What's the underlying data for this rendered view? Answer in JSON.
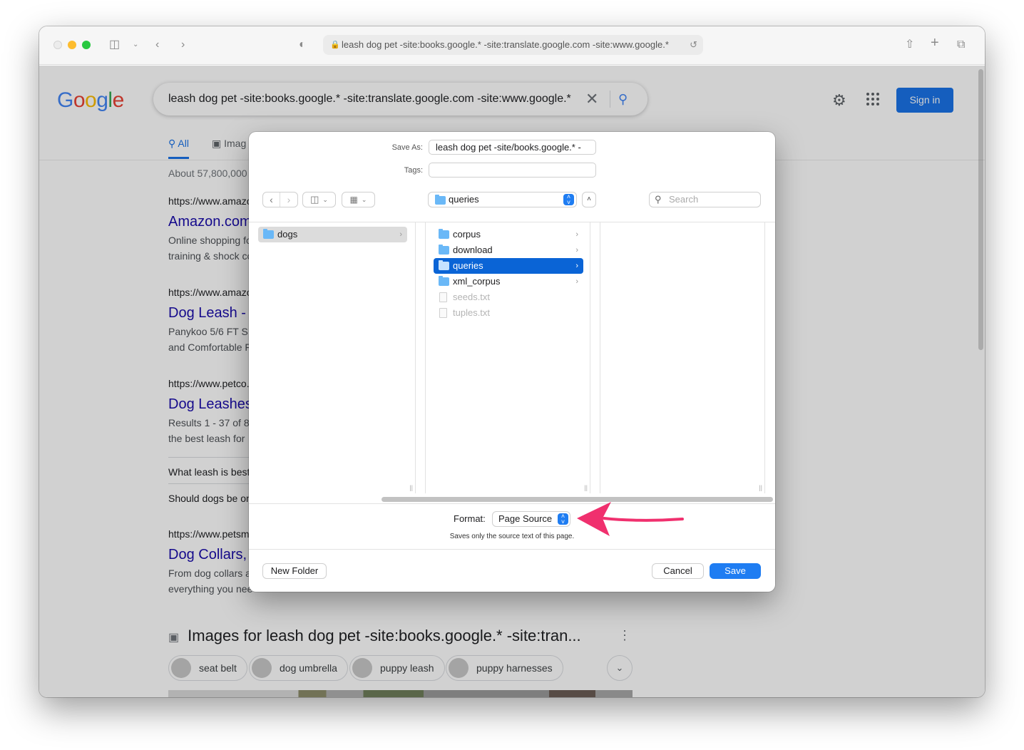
{
  "browser": {
    "address": "leash dog pet -site:books.google.* -site:translate.google.com -site:www.google.*"
  },
  "google": {
    "logo": "Google",
    "query": "leash dog pet -site:books.google.* -site:translate.google.com -site:www.google.*",
    "sign_in": "Sign in",
    "tabs": [
      {
        "label": "All"
      },
      {
        "label": "Imag"
      }
    ],
    "result_count": "About 57,800,000",
    "results": [
      {
        "url": "https://www.amazo",
        "title": "Amazon.com",
        "snippet1": "Online shopping fo",
        "snippet2": "training & shock co"
      },
      {
        "url": "https://www.amazo",
        "title": "Dog Leash -",
        "snippet1": "Panykoo 5/6 FT S",
        "snippet2": "and Comfortable F"
      },
      {
        "url": "https://www.petco.",
        "title": "Dog Leashes",
        "snippet1": "Results 1 - 37 of 8",
        "snippet2": "the best leash for"
      },
      {
        "url": "https://www.petsm",
        "title": "Dog Collars,",
        "snippet1": "From dog collars a",
        "snippet2": "everything you nee"
      }
    ],
    "paa": [
      "What leash is best",
      "Should dogs be on"
    ],
    "images_header": "Images for leash dog pet -site:books.google.* -site:tran...",
    "chips": [
      {
        "label": "seat belt"
      },
      {
        "label": "dog umbrella"
      },
      {
        "label": "puppy leash"
      },
      {
        "label": "puppy harnesses"
      }
    ]
  },
  "dialog": {
    "save_as_label": "Save As:",
    "save_as_value": "leash dog pet -site/books.google.* -",
    "tags_label": "Tags:",
    "tags_value": "",
    "location": "queries",
    "search_placeholder": "Search",
    "col0": [
      {
        "name": "dogs"
      }
    ],
    "col1": [
      {
        "name": "corpus"
      },
      {
        "name": "download"
      },
      {
        "name": "queries"
      },
      {
        "name": "xml_corpus"
      },
      {
        "name": "seeds.txt"
      },
      {
        "name": "tuples.txt"
      }
    ],
    "format_label": "Format:",
    "format_value": "Page Source",
    "format_description": "Saves only the source text of this page.",
    "new_folder": "New Folder",
    "cancel": "Cancel",
    "save": "Save"
  },
  "colors": {
    "accent": "#1f7df2",
    "selection": "#0a64d6",
    "annotation_arrow": "#f0306e",
    "google_link": "#1a0dab"
  }
}
